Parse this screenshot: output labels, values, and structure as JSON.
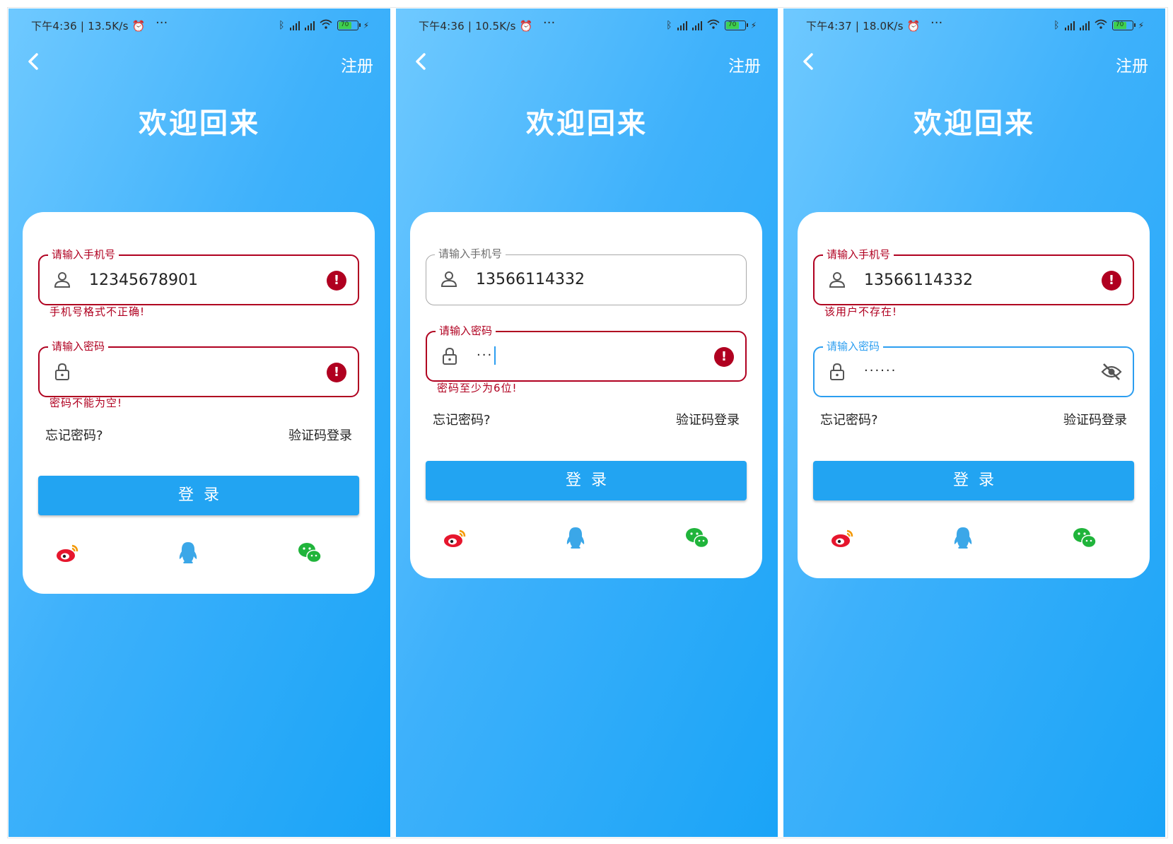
{
  "screens": [
    {
      "status": {
        "time": "下午4:36 | 13.5K/s ⏰",
        "more": "···",
        "battery": "70"
      },
      "nav": {
        "register": "注册"
      },
      "title": "欢迎回来",
      "phone_field": {
        "label": "请输入手机号",
        "value": "12345678901",
        "state": "error",
        "helper": "手机号格式不正确!"
      },
      "password_field": {
        "label": "请输入密码",
        "value": "",
        "state": "error",
        "helper": "密码不能为空!"
      },
      "forgot": "忘记密码?",
      "code_login": "验证码登录",
      "login_button": "登录"
    },
    {
      "status": {
        "time": "下午4:36 | 10.5K/s ⏰",
        "more": "···",
        "battery": "70"
      },
      "nav": {
        "register": "注册"
      },
      "title": "欢迎回来",
      "phone_field": {
        "label": "请输入手机号",
        "value": "13566114332",
        "state": "normal",
        "helper": ""
      },
      "password_field": {
        "label": "请输入密码",
        "value": "···",
        "state": "error",
        "helper": "密码至少为6位!"
      },
      "forgot": "忘记密码?",
      "code_login": "验证码登录",
      "login_button": "登录"
    },
    {
      "status": {
        "time": "下午4:37 | 18.0K/s ⏰",
        "more": "···",
        "battery": "70"
      },
      "nav": {
        "register": "注册"
      },
      "title": "欢迎回来",
      "phone_field": {
        "label": "请输入手机号",
        "value": "13566114332",
        "state": "error",
        "helper": "该用户不存在!"
      },
      "password_field": {
        "label": "请输入密码",
        "value": "······",
        "state": "focused",
        "helper": ""
      },
      "forgot": "忘记密码?",
      "code_login": "验证码登录",
      "login_button": "登录"
    }
  ],
  "social_icons": [
    "weibo-icon",
    "qq-icon",
    "wechat-icon"
  ],
  "colors": {
    "error": "#b00020",
    "accent": "#22a4f2",
    "focus": "#2c9ef0"
  }
}
